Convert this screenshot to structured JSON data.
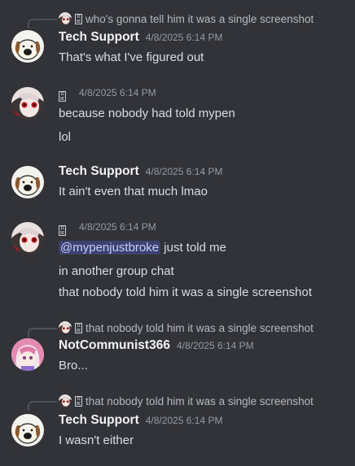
{
  "messages": [
    {
      "reply_text": "who's gonna tell him it was a single screenshot",
      "username": "Tech Support",
      "timestamp": "4/8/2025 6:14 PM",
      "lines": [
        "That's what I've figured out"
      ],
      "avatar": "dog-avatar"
    },
    {
      "username": "",
      "timestamp": "4/8/2025 6:14 PM",
      "lines": [
        "because nobody had told mypen",
        "lol"
      ],
      "avatar": "anime-girl-avatar"
    },
    {
      "username": "Tech Support",
      "timestamp": "4/8/2025 6:14 PM",
      "lines": [
        "It ain't even that much lmao"
      ],
      "avatar": "dog-avatar"
    },
    {
      "username": "",
      "timestamp": "4/8/2025 6:14 PM",
      "mention": "@mypenjustbroke",
      "lines": [
        " just told me",
        "in another group chat",
        "that nobody told him it was a single screenshot"
      ],
      "avatar": "anime-girl-avatar"
    },
    {
      "reply_text": "that nobody told him it was a single screenshot",
      "username": "NotCommunist366",
      "timestamp": "4/8/2025 6:14 PM",
      "lines": [
        "Bro..."
      ],
      "avatar": "pink-hair-avatar"
    },
    {
      "reply_text": "that nobody told him it was a single screenshot",
      "username": "Tech Support",
      "timestamp": "4/8/2025 6:14 PM",
      "lines": [
        "I wasn't either"
      ],
      "avatar": "dog-avatar"
    }
  ],
  "colors": {
    "background": "#313338",
    "username": "#f2f3f5",
    "timestamp": "#949ba4",
    "text": "#dbdee1",
    "mention_bg": "#3c4270",
    "mention_text": "#c9cdfb"
  }
}
